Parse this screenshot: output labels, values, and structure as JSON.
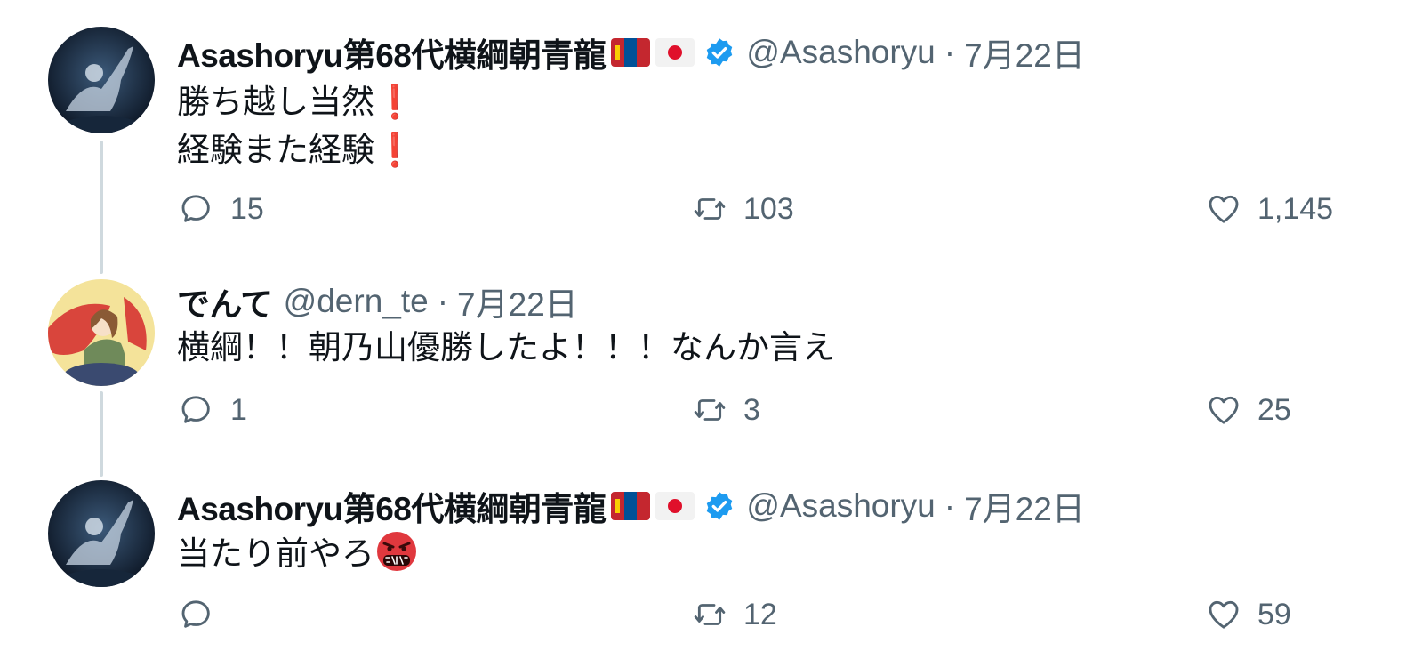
{
  "tweets": [
    {
      "display_name": "Asashoryu第68代横綱朝青龍",
      "flags": [
        "mongolia-flag",
        "japan-flag"
      ],
      "verified": true,
      "handle": "@Asashoryu",
      "separator": "·",
      "date": "7月22日",
      "lines": [
        "勝ち越し当然",
        "経験また経験"
      ],
      "line_suffix": "❗",
      "replies": "15",
      "retweets": "103",
      "likes": "1,145"
    },
    {
      "display_name": "でんて",
      "handle": "@dern_te",
      "separator": "·",
      "date": "7月22日",
      "lines": [
        "横綱！！朝乃山優勝したよ！！！なんか言え"
      ],
      "replies": "1",
      "retweets": "3",
      "likes": "25"
    },
    {
      "display_name": "Asashoryu第68代横綱朝青龍",
      "flags": [
        "mongolia-flag",
        "japan-flag"
      ],
      "verified": true,
      "handle": "@Asashoryu",
      "separator": "·",
      "date": "7月22日",
      "lines": [
        "当たり前やろ"
      ],
      "emoji": "face-with-symbols-on-mouth",
      "replies": "",
      "retweets": "12",
      "likes": "59"
    }
  ],
  "colors": {
    "text": "#0f1419",
    "secondary": "#536471",
    "verified": "#1d9bf0",
    "thread_line": "#cfd9de",
    "exclamation": "#d01c30"
  }
}
